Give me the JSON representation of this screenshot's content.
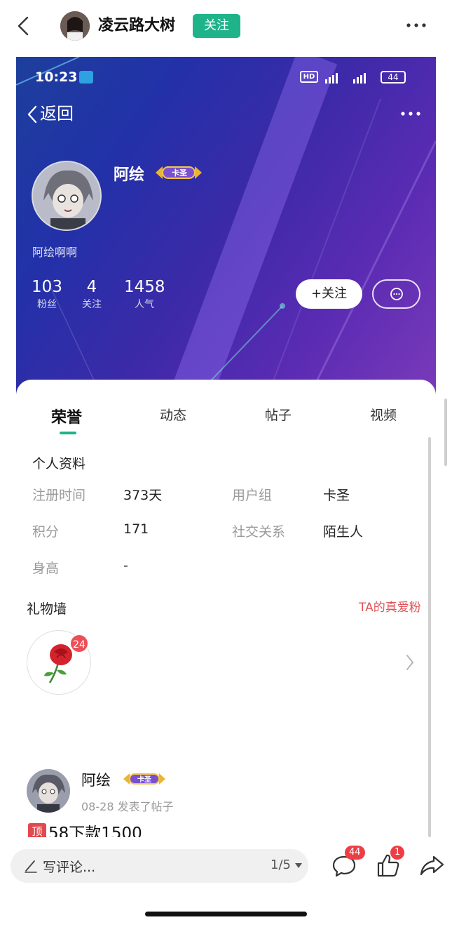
{
  "topbar": {
    "user_name": "凌云路大树",
    "follow_label": "关注"
  },
  "screenshot": {
    "status": {
      "time": "10:23",
      "hd": "HD",
      "battery": "44"
    },
    "nav": {
      "back_label": "返回"
    },
    "profile": {
      "name": "阿绘",
      "rank": "卡圣",
      "signature": "阿绘啊啊",
      "stats": [
        {
          "value": "103",
          "label": "粉丝"
        },
        {
          "value": "4",
          "label": "关注"
        },
        {
          "value": "1458",
          "label": "人气"
        }
      ],
      "follow_label": "+关注"
    },
    "tabs": [
      "荣誉",
      "动态",
      "帖子",
      "视频"
    ],
    "info": {
      "title": "个人资料",
      "rows": [
        {
          "label": "注册时间",
          "value": "373天"
        },
        {
          "label": "用户组",
          "value": "卡圣"
        },
        {
          "label": "积分",
          "value": "171"
        },
        {
          "label": "社交关系",
          "value": "陌生人"
        },
        {
          "label": "身高",
          "value": "-"
        }
      ]
    },
    "gifts": {
      "title": "礼物墙",
      "true_fans_label": "TA的真爱粉",
      "rose_count": "24"
    },
    "post": {
      "author": "阿绘",
      "rank": "卡圣",
      "date": "08-28",
      "action": "发表了帖子",
      "pin_label": "顶",
      "title": "58下款1500"
    }
  },
  "bottom": {
    "comment_placeholder": "写评论...",
    "page_indicator": "1/5",
    "comment_count": "44",
    "like_count": "1"
  },
  "colors": {
    "accent_green": "#1fb38a",
    "badge_red": "#ee3e45",
    "fans_red": "#e0545a"
  },
  "icons": [
    "back-icon",
    "more-icon",
    "message-icon",
    "chevron-right-icon",
    "pen-icon",
    "comment-icon",
    "like-icon",
    "share-icon",
    "rose-icon"
  ]
}
